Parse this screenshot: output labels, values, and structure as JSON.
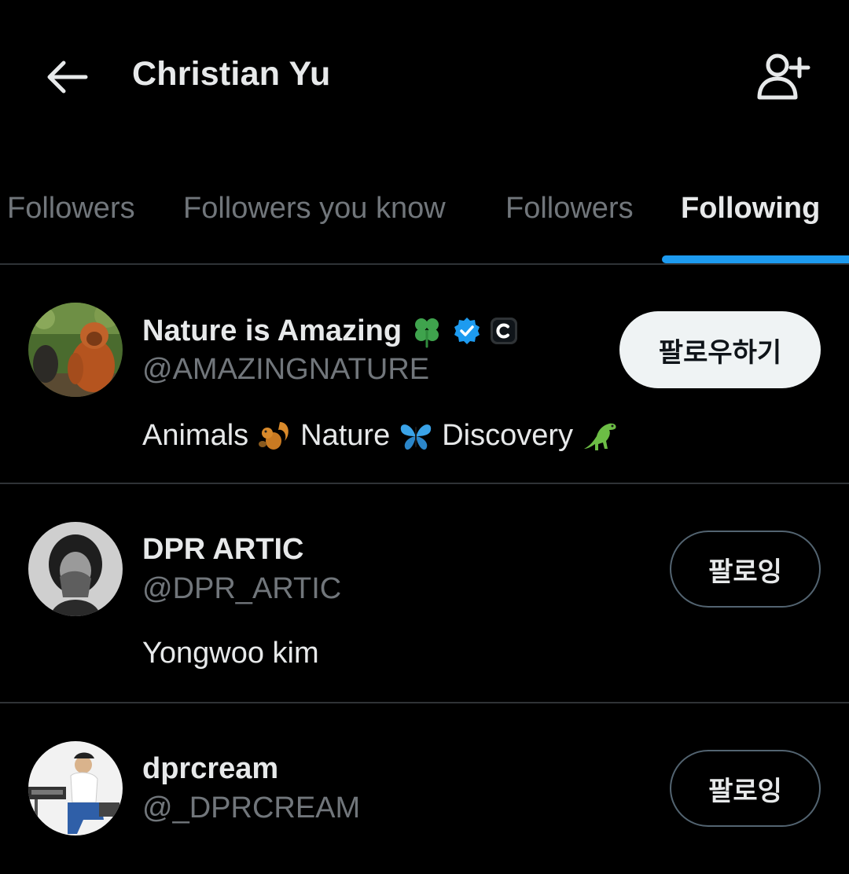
{
  "header": {
    "title": "Christian Yu",
    "back_icon": "arrow-left-icon",
    "add_user_icon": "add-user-icon"
  },
  "tabs": [
    {
      "label": "Followers",
      "active": false
    },
    {
      "label": "Followers you know",
      "active": false
    },
    {
      "label": "Followers",
      "active": false
    },
    {
      "label": "Following",
      "active": true
    }
  ],
  "users": [
    {
      "name": "Nature is Amazing",
      "name_badges": [
        "four-leaf-clover-icon",
        "verified-badge-icon",
        "copyright-c-icon"
      ],
      "handle": "@AMAZINGNATURE",
      "bio_parts": [
        "Animals",
        "Nature",
        "Discovery"
      ],
      "bio_icons": [
        "squirrel-icon",
        "butterfly-icon",
        "dinosaur-icon"
      ],
      "button_label": "팔로우하기",
      "following": false
    },
    {
      "name": "DPR ARTIC",
      "handle": "@DPR_ARTIC",
      "bio": "Yongwoo kim",
      "button_label": "팔로잉",
      "following": true
    },
    {
      "name": "dprcream",
      "handle": "@_DPRCREAM",
      "button_label": "팔로잉",
      "following": true
    }
  ],
  "colors": {
    "background": "#000000",
    "text_primary": "#e7e9ea",
    "text_secondary": "#71767b",
    "accent": "#1d9bf0",
    "divider": "#2f3336"
  }
}
